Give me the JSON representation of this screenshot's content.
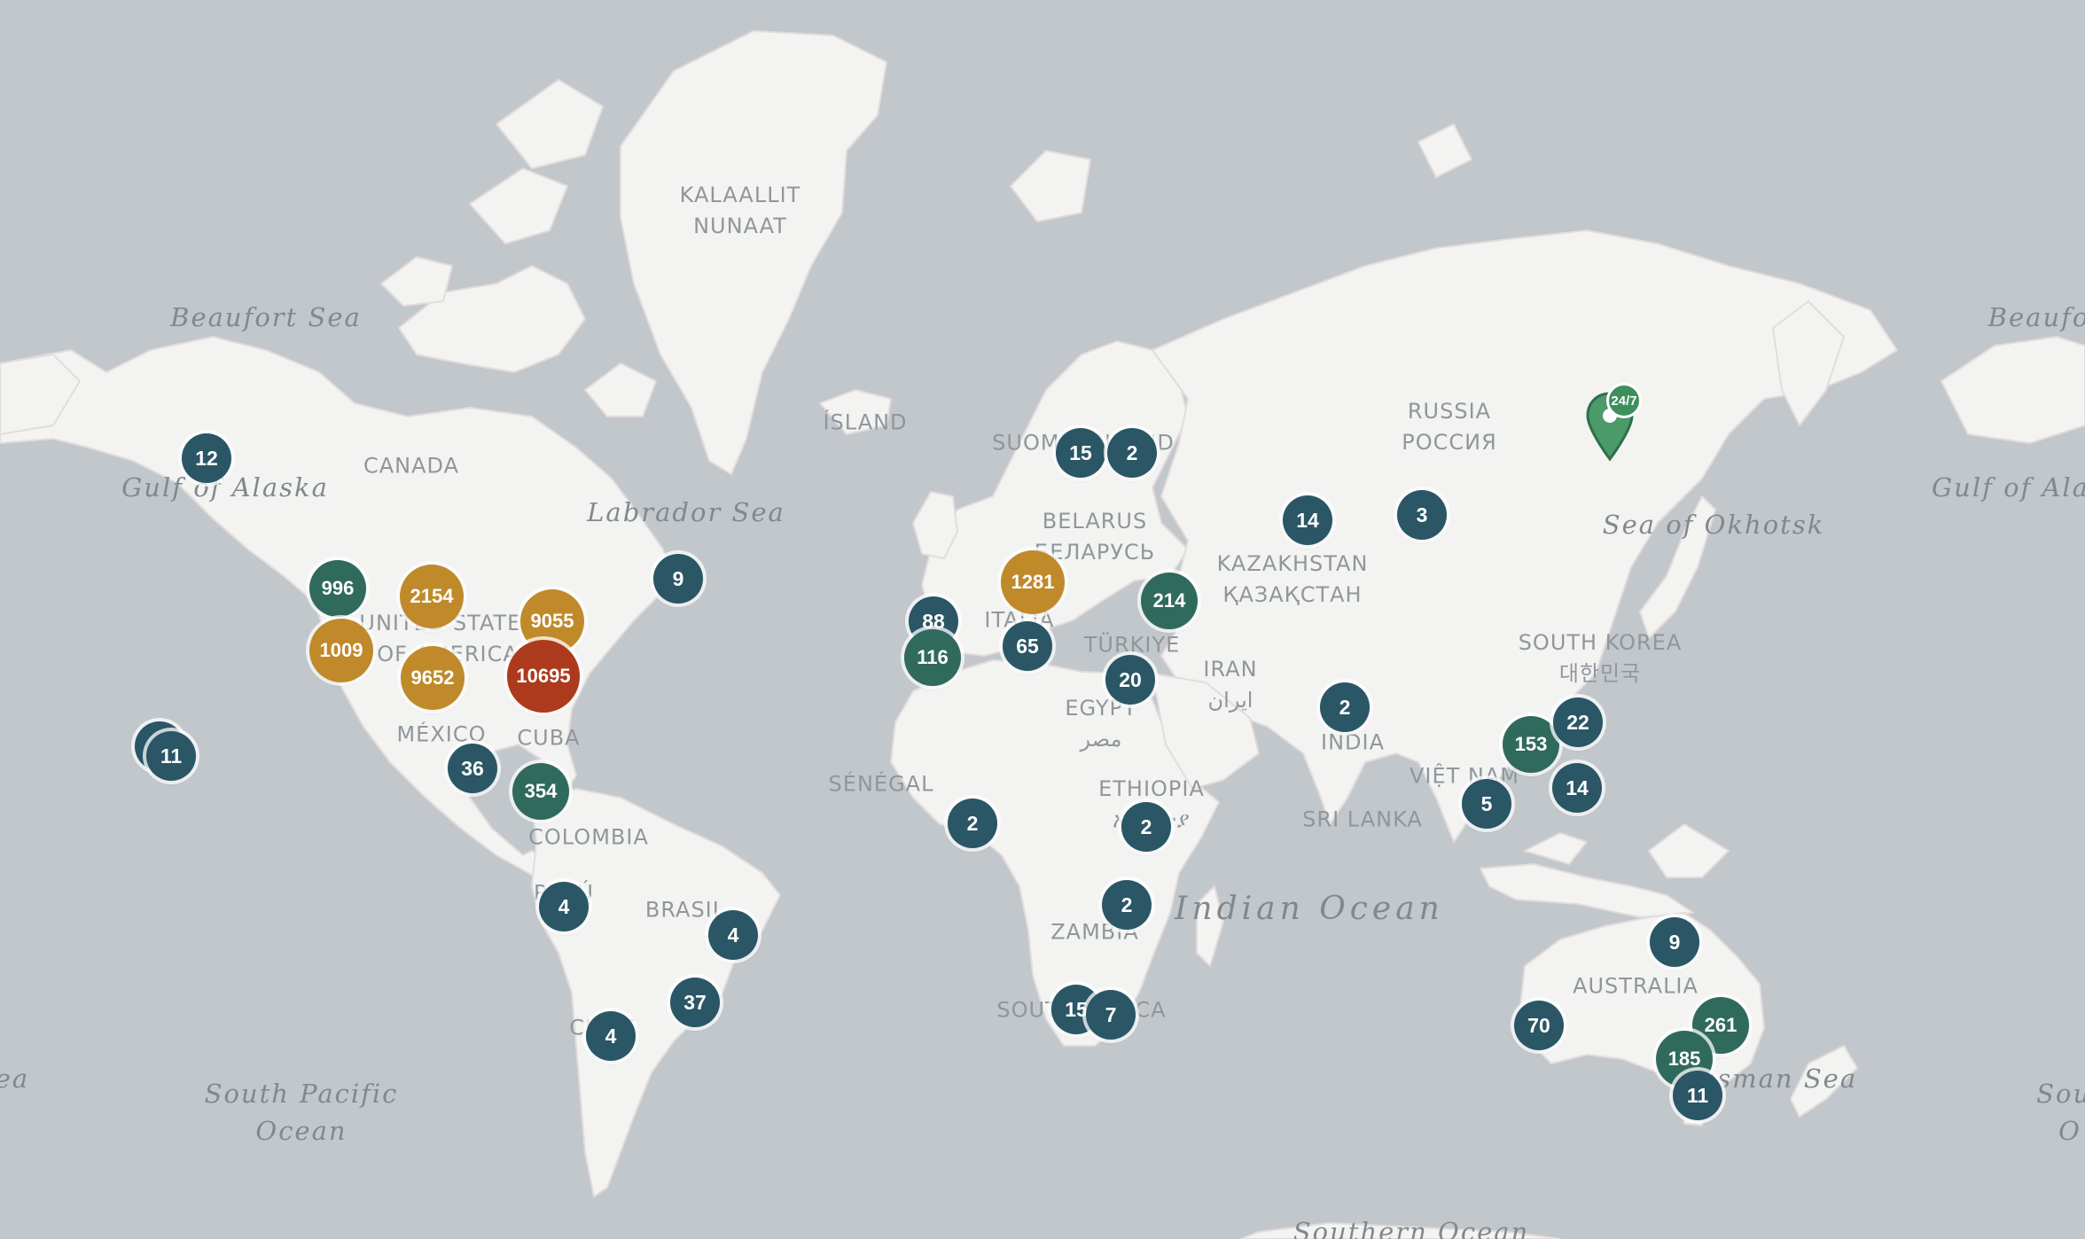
{
  "colors": {
    "water": "#c2c7cb",
    "land": "#f3f3f2",
    "small_cluster": "#2a5666",
    "medium_cluster": "#306a5c",
    "large_cluster": "#c08a2a",
    "huge_cluster": "#ad3a1d",
    "marker": "#4a9a6a"
  },
  "labels": {
    "greenland": "KALAALLIT\nNUNAAT",
    "beaufort_sea_left": "Beaufort Sea",
    "beaufort_sea_right": "Beaufo",
    "canada": "CANADA",
    "gulf_of_alaska_left": "Gulf of Alaska",
    "gulf_of_alaska_right": "Gulf of Ala",
    "labrador_sea": "Labrador Sea",
    "island": "ÍSLAND",
    "usa": "UNITED STATES\nOF AMERICA",
    "mexico": "MÉXICO",
    "cuba": "CUBA",
    "colombia": "COLOMBIA",
    "peru": "PERÚ",
    "brasil": "BRASIL",
    "chile": "CHILE",
    "south_pacific": "South Pacific\nOcean",
    "south_pacific_right": "Sout\nO",
    "sea_left": "ea",
    "suomi_finland": "SUOMI FINLAND",
    "belarus": "BELARUS\nБЕЛАРУСЬ",
    "italia": "ITALIA",
    "turkiye": "TÜRKIYE",
    "egypt": "EGYPT\nمصر",
    "senegal": "SÉNÉGAL",
    "ethiopia": "ETHIOPIA\nኢትዮጵያ",
    "zambia": "ZAMBIA",
    "south_africa": "SOUTH AFRICA",
    "russia": "RUSSIA\nРОССИЯ",
    "kazakhstan": "KAZAKHSTAN\nҚАЗАҚСТАН",
    "iran": "IRAN\nایران",
    "india": "INDIA",
    "sri_lanka": "SRI LANKA",
    "viet_nam": "VIỆT NAM",
    "south_korea": "SOUTH KOREA\n대한민국",
    "sea_of_okhotsk": "Sea of Okhotsk",
    "indian_ocean": "Indian Ocean",
    "australia": "AUSTRALIA",
    "tasman_sea": "Tasman Sea",
    "southern_ocean": "Southern Ocean"
  },
  "clusters": [
    {
      "id": "alaska",
      "count": "12",
      "tier": "small"
    },
    {
      "id": "hawaii-a",
      "count": "",
      "tier": "small"
    },
    {
      "id": "hawaii-b",
      "count": "11",
      "tier": "small"
    },
    {
      "id": "seattle",
      "count": "996",
      "tier": "medium"
    },
    {
      "id": "california",
      "count": "1009",
      "tier": "large"
    },
    {
      "id": "mountain",
      "count": "2154",
      "tier": "large"
    },
    {
      "id": "texas",
      "count": "9652",
      "tier": "large"
    },
    {
      "id": "northeast",
      "count": "9055",
      "tier": "large"
    },
    {
      "id": "southeast",
      "count": "10695",
      "tier": "huge"
    },
    {
      "id": "newfoundland",
      "count": "9",
      "tier": "small"
    },
    {
      "id": "central-america",
      "count": "36",
      "tier": "small"
    },
    {
      "id": "caribbean",
      "count": "354",
      "tier": "medium"
    },
    {
      "id": "peru",
      "count": "4",
      "tier": "small"
    },
    {
      "id": "brazil-ne",
      "count": "4",
      "tier": "small"
    },
    {
      "id": "brazil-s",
      "count": "37",
      "tier": "small"
    },
    {
      "id": "chile",
      "count": "4",
      "tier": "small"
    },
    {
      "id": "uk-france",
      "count": "88",
      "tier": "small"
    },
    {
      "id": "spain",
      "count": "116",
      "tier": "medium"
    },
    {
      "id": "central-europe",
      "count": "1281",
      "tier": "large"
    },
    {
      "id": "italy",
      "count": "65",
      "tier": "small"
    },
    {
      "id": "sweden",
      "count": "15",
      "tier": "small"
    },
    {
      "id": "finland",
      "count": "2",
      "tier": "small"
    },
    {
      "id": "turkey",
      "count": "214",
      "tier": "medium"
    },
    {
      "id": "middle-east",
      "count": "20",
      "tier": "small"
    },
    {
      "id": "west-africa",
      "count": "2",
      "tier": "small"
    },
    {
      "id": "east-africa",
      "count": "2",
      "tier": "small"
    },
    {
      "id": "mozambique",
      "count": "2",
      "tier": "small"
    },
    {
      "id": "south-africa-a",
      "count": "15",
      "tier": "small"
    },
    {
      "id": "south-africa-b",
      "count": "7",
      "tier": "small"
    },
    {
      "id": "kazakhstan",
      "count": "14",
      "tier": "small"
    },
    {
      "id": "russia",
      "count": "3",
      "tier": "small"
    },
    {
      "id": "india",
      "count": "2",
      "tier": "small"
    },
    {
      "id": "china-south",
      "count": "153",
      "tier": "medium"
    },
    {
      "id": "taiwan",
      "count": "22",
      "tier": "small"
    },
    {
      "id": "philippines",
      "count": "14",
      "tier": "small"
    },
    {
      "id": "se-asia",
      "count": "5",
      "tier": "small"
    },
    {
      "id": "australia-n",
      "count": "9",
      "tier": "small"
    },
    {
      "id": "perth",
      "count": "70",
      "tier": "small"
    },
    {
      "id": "sydney",
      "count": "261",
      "tier": "medium"
    },
    {
      "id": "melbourne",
      "count": "185",
      "tier": "medium"
    },
    {
      "id": "tasmania",
      "count": "11",
      "tier": "small"
    }
  ],
  "marker": {
    "badge": "24/7",
    "icon": "location-pin-icon"
  }
}
